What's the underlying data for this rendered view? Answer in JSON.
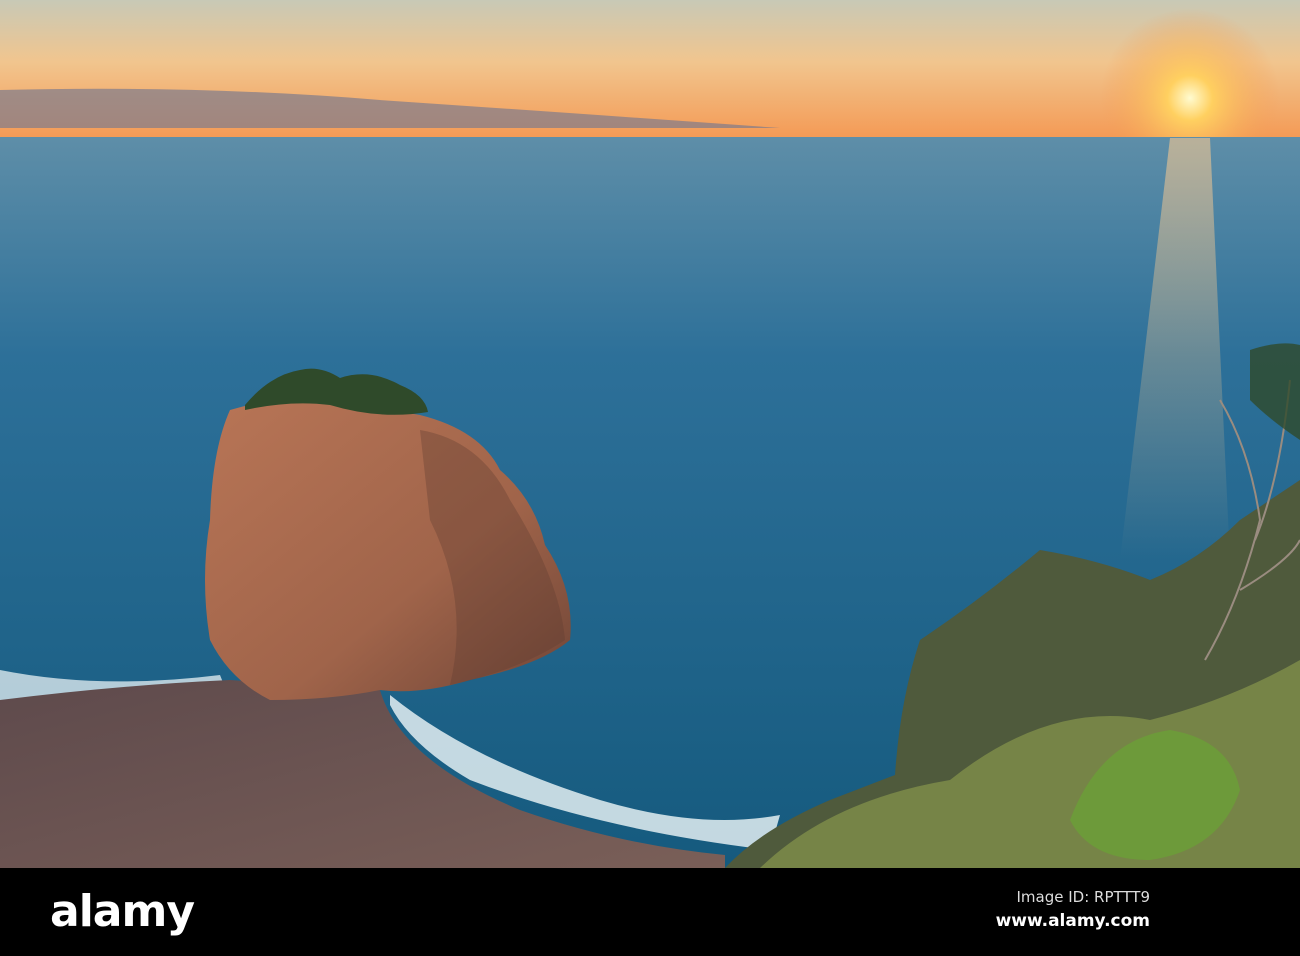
{
  "photo": {
    "subject": "sea stack on beach at sunrise",
    "colors": {
      "sky_top": "#c9c6b0",
      "sky_horizon": "#f4a35a",
      "sun": "#fff4b0",
      "sea": "#1f6f96",
      "rock": "#a8684a",
      "sand": "#6b5452"
    }
  },
  "watermark": {
    "brand": "alamy"
  },
  "footer": {
    "logo": "alamy",
    "image_id": "Image ID: RPTTT9",
    "url": "www.alamy.com"
  }
}
